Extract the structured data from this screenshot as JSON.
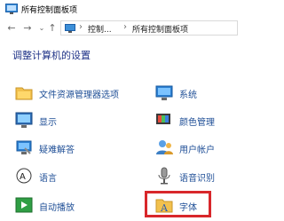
{
  "window": {
    "title": "所有控制面板项"
  },
  "addressbar": {
    "crumbs": [
      "控制...",
      "所有控制面板项"
    ],
    "separator": "›"
  },
  "page": {
    "title": "调整计算机的设置"
  },
  "items": [
    {
      "label": "文件资源管理器选项",
      "icon": "folder-options-icon"
    },
    {
      "label": "系统",
      "icon": "system-icon"
    },
    {
      "label": "显示",
      "icon": "display-icon"
    },
    {
      "label": "颜色管理",
      "icon": "color-management-icon"
    },
    {
      "label": "疑难解答",
      "icon": "troubleshooting-icon"
    },
    {
      "label": "用户帐户",
      "icon": "user-accounts-icon"
    },
    {
      "label": "语言",
      "icon": "language-icon"
    },
    {
      "label": "语音识别",
      "icon": "speech-recognition-icon"
    },
    {
      "label": "自动播放",
      "icon": "autoplay-icon"
    },
    {
      "label": "字体",
      "icon": "fonts-icon"
    }
  ],
  "colors": {
    "link": "#1e4e96",
    "title": "#1e3287",
    "highlight": "#d8272b"
  }
}
